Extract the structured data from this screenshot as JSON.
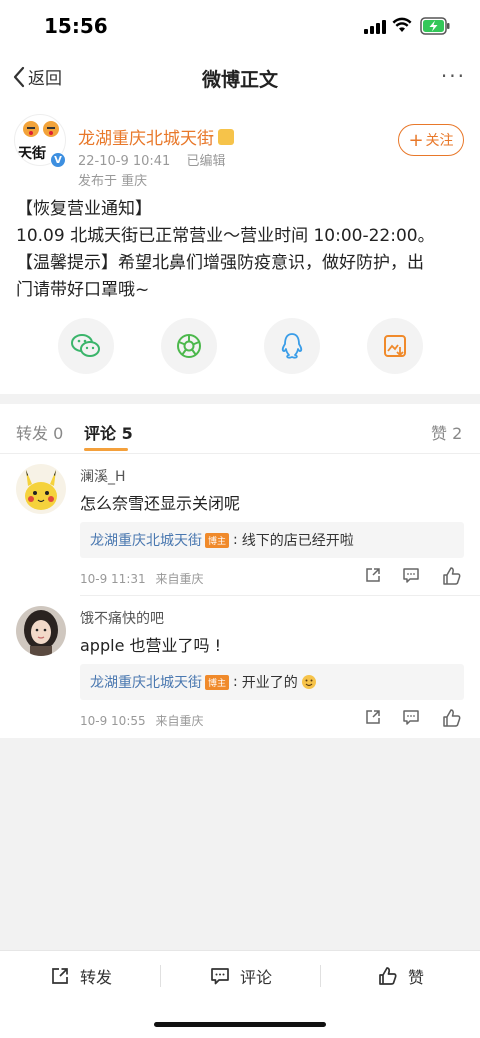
{
  "status_bar": {
    "time": "15:56",
    "icons": [
      "signal-icon",
      "wifi-icon",
      "battery-charging-icon"
    ]
  },
  "nav": {
    "back_label": "返回",
    "title": "微博正文",
    "more_label": "···"
  },
  "post": {
    "avatar_text": "天街",
    "author": "龙湖重庆北城天街",
    "date": "22-10-9 10:41",
    "edited": "已编辑",
    "published_from": "发布于 重庆",
    "follow_label": "关注",
    "body_lines": [
      "【恢复营业通知】",
      "10.09 北城天街已正常营业～营业时间 10:00-22:00。",
      "【温馨提示】希望北鼻们增强防疫意识，做好防护，出",
      "门请带好口罩哦~"
    ],
    "share_icons": [
      "wechat-icon",
      "moments-icon",
      "qq-icon",
      "save-image-icon"
    ]
  },
  "tabs": {
    "repost": "转发 0",
    "comments": "评论 5",
    "likes": "赞 2"
  },
  "comments": [
    {
      "user": "澜溪_H",
      "text": "怎么奈雪还显示关闭呢",
      "reply_user": "龙湖重庆北城天街",
      "host_badge": "博主",
      "reply_text": "线下的店已经开啦",
      "time": "10-9 11:31",
      "location": "来自重庆"
    },
    {
      "user": "饿不痛快的吧",
      "text": "apple 也营业了吗 !",
      "reply_user": "龙湖重庆北城天街",
      "host_badge": "博主",
      "reply_text": "开业了的",
      "time": "10-9 10:55",
      "location": "来自重庆"
    }
  ],
  "bottom_bar": {
    "repost": "转发",
    "comment": "评论",
    "like": "赞"
  },
  "colors": {
    "accent": "#e8782a",
    "link": "#4a78b0",
    "host_badge": "#f08a2b",
    "tab_underline": "#f4a03b"
  }
}
